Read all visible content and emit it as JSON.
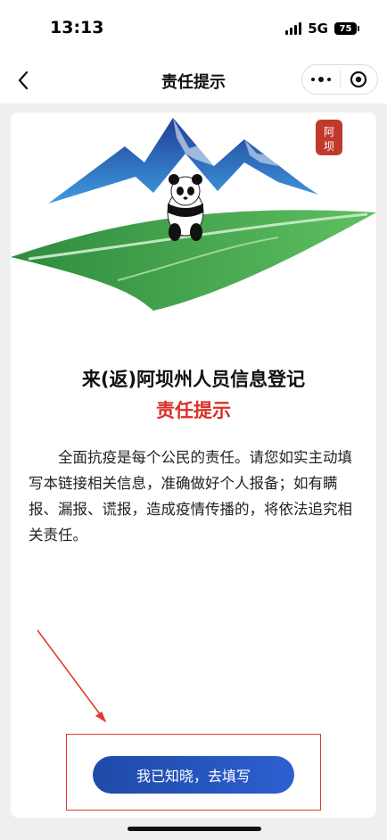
{
  "status_bar": {
    "time": "13:13",
    "network": "5G",
    "battery": "75"
  },
  "nav": {
    "title": "责任提示",
    "back_icon": "chevron-left-icon",
    "more_icon": "more-dots-icon",
    "close_icon": "target-circle-icon"
  },
  "banner": {
    "logo_text": "阿坝"
  },
  "content": {
    "title": "来(返)阿坝州人员信息登记",
    "subtitle": "责任提示",
    "notice": "全面抗疫是每个公民的责任。请您如实主动填写本链接相关信息，准确做好个人报备；如有瞒报、漏报、谎报，造成疫情传播的，将依法追究相关责任。"
  },
  "action": {
    "confirm_label": "我已知晓，去填写"
  },
  "colors": {
    "accent_red": "#d93025",
    "button_blue": "#2c5fd0",
    "annotation_red": "#e23b2e"
  }
}
